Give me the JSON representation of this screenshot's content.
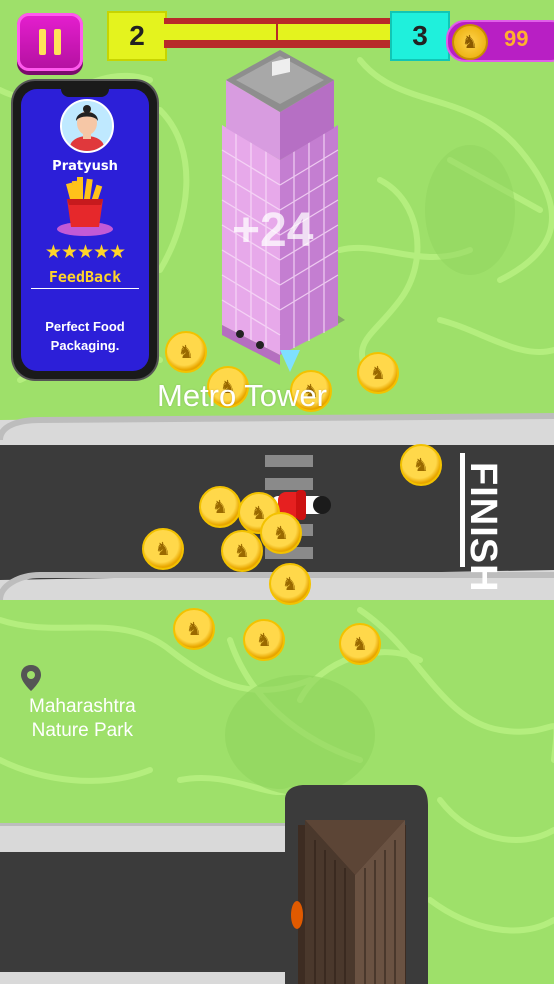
{
  "hud": {
    "level_current": "2",
    "level_next": "3",
    "level_progress": 1.0,
    "coin_count": "99"
  },
  "feedback_card": {
    "name": "Pratyush",
    "rating_stars": "★★★★★",
    "title": "FeedBack",
    "line1": "Perfect Food",
    "line2": "Packaging."
  },
  "map": {
    "building_label": "Metro Tower",
    "floating_score": "+24",
    "finish_label": "FINISH",
    "park_line1": "Maharashtra",
    "park_line2": "Nature Park"
  },
  "icons": {
    "coin_icon": "coin-icon",
    "pause_icon": "pause-icon",
    "location_pin_icon": "location-pin-icon"
  },
  "colors": {
    "grass": "#9ee06a",
    "road": "#3b3b3b",
    "pause": "#d816c2",
    "level_current": "#e4f31e",
    "level_next": "#1ff0dc",
    "coin_pill": "#b81fc4"
  }
}
